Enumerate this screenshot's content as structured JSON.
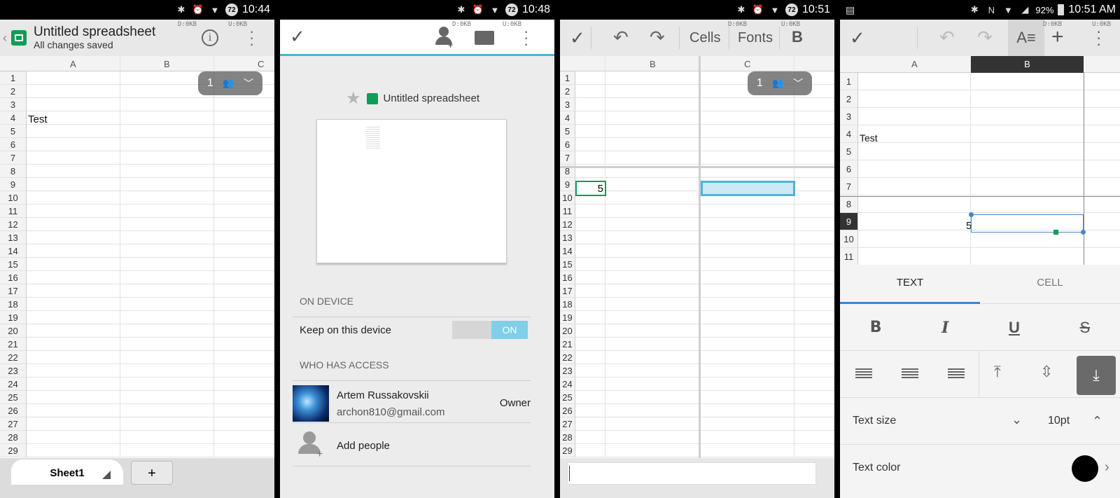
{
  "colors": {
    "accent": "#0f9d58",
    "selection": "#4fb3d9",
    "toggle_on": "#7fcfe8"
  },
  "p1": {
    "status": {
      "time": "10:44",
      "battery": "72"
    },
    "kb_left": "D:0KB",
    "kb_right": "U:0KB",
    "title": "Untitled spreadsheet",
    "subtitle": "All changes saved",
    "cols": [
      "A",
      "B",
      "C"
    ],
    "rows": [
      "1",
      "2",
      "3",
      "4",
      "5",
      "6",
      "7",
      "8",
      "9",
      "10",
      "11",
      "12",
      "13",
      "14",
      "15",
      "16",
      "17",
      "18",
      "19",
      "20",
      "21",
      "22",
      "23",
      "24",
      "25",
      "26",
      "27",
      "28",
      "29"
    ],
    "cell_a4": "Test",
    "collab_count": "1",
    "sheet_tab": "Sheet1",
    "add_sheet": "+"
  },
  "p2": {
    "status": {
      "time": "10:48",
      "battery": "72"
    },
    "kb_left": "D:0KB",
    "kb_right": "U:0KB",
    "doc_title": "Untitled spreadsheet",
    "on_device_header": "ON DEVICE",
    "keep_label": "Keep on this device",
    "toggle_on": "ON",
    "access_header": "WHO HAS ACCESS",
    "owner_name": "Artem Russakovskii",
    "owner_email": "archon810@gmail.com",
    "owner_role": "Owner",
    "add_people": "Add people"
  },
  "p3": {
    "status": {
      "time": "10:51",
      "battery": "72"
    },
    "kb_left": "D:0KB",
    "kb_right": "U:0KB",
    "cells_label": "Cells",
    "fonts_label": "Fonts",
    "bold_label": "B",
    "cols": [
      "B",
      "C"
    ],
    "rows": [
      "1",
      "2",
      "3",
      "4",
      "5",
      "6",
      "7",
      "8",
      "9",
      "10",
      "11",
      "12",
      "13",
      "14",
      "15",
      "16",
      "17",
      "18",
      "19",
      "20",
      "21",
      "22",
      "23",
      "24",
      "25",
      "26",
      "27",
      "28",
      "29"
    ],
    "cell_value": "5",
    "collab_count": "1"
  },
  "p4": {
    "status": {
      "time": "10:51 AM",
      "battery": "92%"
    },
    "kb_left": "D:0KB",
    "kb_right": "U:0KB",
    "cols": [
      "A",
      "B"
    ],
    "rows": [
      "1",
      "2",
      "3",
      "4",
      "5",
      "6",
      "7",
      "8",
      "9",
      "10",
      "11"
    ],
    "cell_a4": "Test",
    "cell_a9": "5",
    "tab_text": "TEXT",
    "tab_cell": "CELL",
    "fmt_bold": "B",
    "fmt_italic": "I",
    "fmt_underline": "U",
    "fmt_strike": "S",
    "text_size_label": "Text size",
    "text_size_value": "10pt",
    "text_color_label": "Text color"
  }
}
